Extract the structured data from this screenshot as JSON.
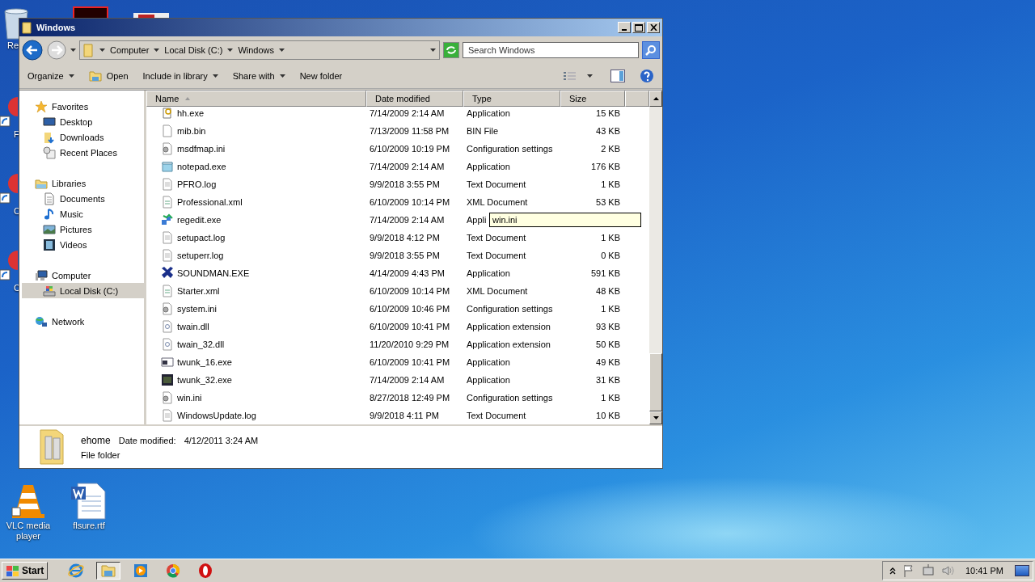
{
  "desktop": {
    "icons": [
      {
        "label": "Re",
        "kind": "recycle"
      },
      {
        "label": "F",
        "kind": "shortcut"
      },
      {
        "label": "C",
        "kind": "shortcut"
      },
      {
        "label": "C",
        "kind": "shortcut"
      }
    ],
    "bottom_icons": [
      {
        "label": "VLC media player",
        "kind": "vlc"
      },
      {
        "label": "flsure.rtf",
        "kind": "word"
      }
    ]
  },
  "window": {
    "title": "Windows",
    "breadcrumb": [
      "Computer",
      "Local Disk (C:)",
      "Windows"
    ],
    "search": {
      "placeholder": "Search Windows"
    },
    "toolbar": [
      {
        "label": "Organize",
        "dropdown": true
      },
      {
        "label": "Open",
        "dropdown": false,
        "icon": true
      },
      {
        "label": "Include in library",
        "dropdown": true
      },
      {
        "label": "Share with",
        "dropdown": true
      },
      {
        "label": "New folder",
        "dropdown": false
      }
    ],
    "sidebar": [
      {
        "label": "Favorites",
        "kind": "star",
        "children": [
          {
            "label": "Desktop",
            "kind": "desktop",
            "selected": false
          },
          {
            "label": "Downloads",
            "kind": "downloads",
            "selected": false
          },
          {
            "label": "Recent Places",
            "kind": "recent",
            "selected": false
          }
        ]
      },
      {
        "label": "Libraries",
        "kind": "library",
        "children": [
          {
            "label": "Documents",
            "kind": "doc",
            "selected": false
          },
          {
            "label": "Music",
            "kind": "music",
            "selected": false
          },
          {
            "label": "Pictures",
            "kind": "pictures",
            "selected": false
          },
          {
            "label": "Videos",
            "kind": "videos",
            "selected": false
          }
        ]
      },
      {
        "label": "Computer",
        "kind": "computer",
        "children": [
          {
            "label": "Local Disk (C:)",
            "kind": "disk",
            "selected": true
          }
        ]
      },
      {
        "label": "Network",
        "kind": "network"
      }
    ],
    "table": {
      "columns": [
        "Name",
        "Date modified",
        "Type",
        "Size"
      ],
      "rows": [
        {
          "name": "hh.exe",
          "date": "7/14/2009 2:14 AM",
          "type": "Application",
          "size": "15 KB",
          "kind": "help"
        },
        {
          "name": "mib.bin",
          "date": "7/13/2009 11:58 PM",
          "type": "BIN File",
          "size": "43 KB",
          "kind": "blank"
        },
        {
          "name": "msdfmap.ini",
          "date": "6/10/2009 10:19 PM",
          "type": "Configuration settings",
          "size": "2 KB",
          "kind": "config"
        },
        {
          "name": "notepad.exe",
          "date": "7/14/2009 2:14 AM",
          "type": "Application",
          "size": "176 KB",
          "kind": "notepad"
        },
        {
          "name": "PFRO.log",
          "date": "9/9/2018 3:55 PM",
          "type": "Text Document",
          "size": "1 KB",
          "kind": "text"
        },
        {
          "name": "Professional.xml",
          "date": "6/10/2009 10:14 PM",
          "type": "XML Document",
          "size": "53 KB",
          "kind": "xml"
        },
        {
          "name": "regedit.exe",
          "date": "7/14/2009 2:14 AM",
          "type": "Appli",
          "kind": "regedit",
          "tooltip": "win.ini"
        },
        {
          "name": "setupact.log",
          "date": "9/9/2018 4:12 PM",
          "type": "Text Document",
          "size": "1 KB",
          "kind": "text"
        },
        {
          "name": "setuperr.log",
          "date": "9/9/2018 3:55 PM",
          "type": "Text Document",
          "size": "0 KB",
          "kind": "text"
        },
        {
          "name": "SOUNDMAN.EXE",
          "date": "4/14/2009 4:43 PM",
          "type": "Application",
          "size": "591 KB",
          "kind": "sound"
        },
        {
          "name": "Starter.xml",
          "date": "6/10/2009 10:14 PM",
          "type": "XML Document",
          "size": "48 KB",
          "kind": "xml"
        },
        {
          "name": "system.ini",
          "date": "6/10/2009 10:46 PM",
          "type": "Configuration settings",
          "size": "1 KB",
          "kind": "config"
        },
        {
          "name": "twain.dll",
          "date": "6/10/2009 10:41 PM",
          "type": "Application extension",
          "size": "93 KB",
          "kind": "dll"
        },
        {
          "name": "twain_32.dll",
          "date": "11/20/2010 9:29 PM",
          "type": "Application extension",
          "size": "50 KB",
          "kind": "dll"
        },
        {
          "name": "twunk_16.exe",
          "date": "6/10/2009 10:41 PM",
          "type": "Application",
          "size": "49 KB",
          "kind": "window"
        },
        {
          "name": "twunk_32.exe",
          "date": "7/14/2009 2:14 AM",
          "type": "Application",
          "size": "31 KB",
          "kind": "dark"
        },
        {
          "name": "win.ini",
          "date": "8/27/2018 12:49 PM",
          "type": "Configuration settings",
          "size": "1 KB",
          "kind": "config"
        },
        {
          "name": "WindowsUpdate.log",
          "date": "9/9/2018 4:11 PM",
          "type": "Text Document",
          "size": "10 KB",
          "kind": "text"
        }
      ]
    },
    "details": {
      "name": "ehome",
      "date_label": "Date modified:",
      "date": "4/12/2011 3:24 AM",
      "type": "File folder"
    }
  },
  "taskbar": {
    "start": "Start",
    "apps": [
      {
        "kind": "ie",
        "selected": false
      },
      {
        "kind": "explorer",
        "selected": true
      },
      {
        "kind": "media",
        "selected": false
      },
      {
        "kind": "chrome",
        "selected": false
      },
      {
        "kind": "opera",
        "selected": false
      }
    ],
    "time": "10:41 PM"
  }
}
